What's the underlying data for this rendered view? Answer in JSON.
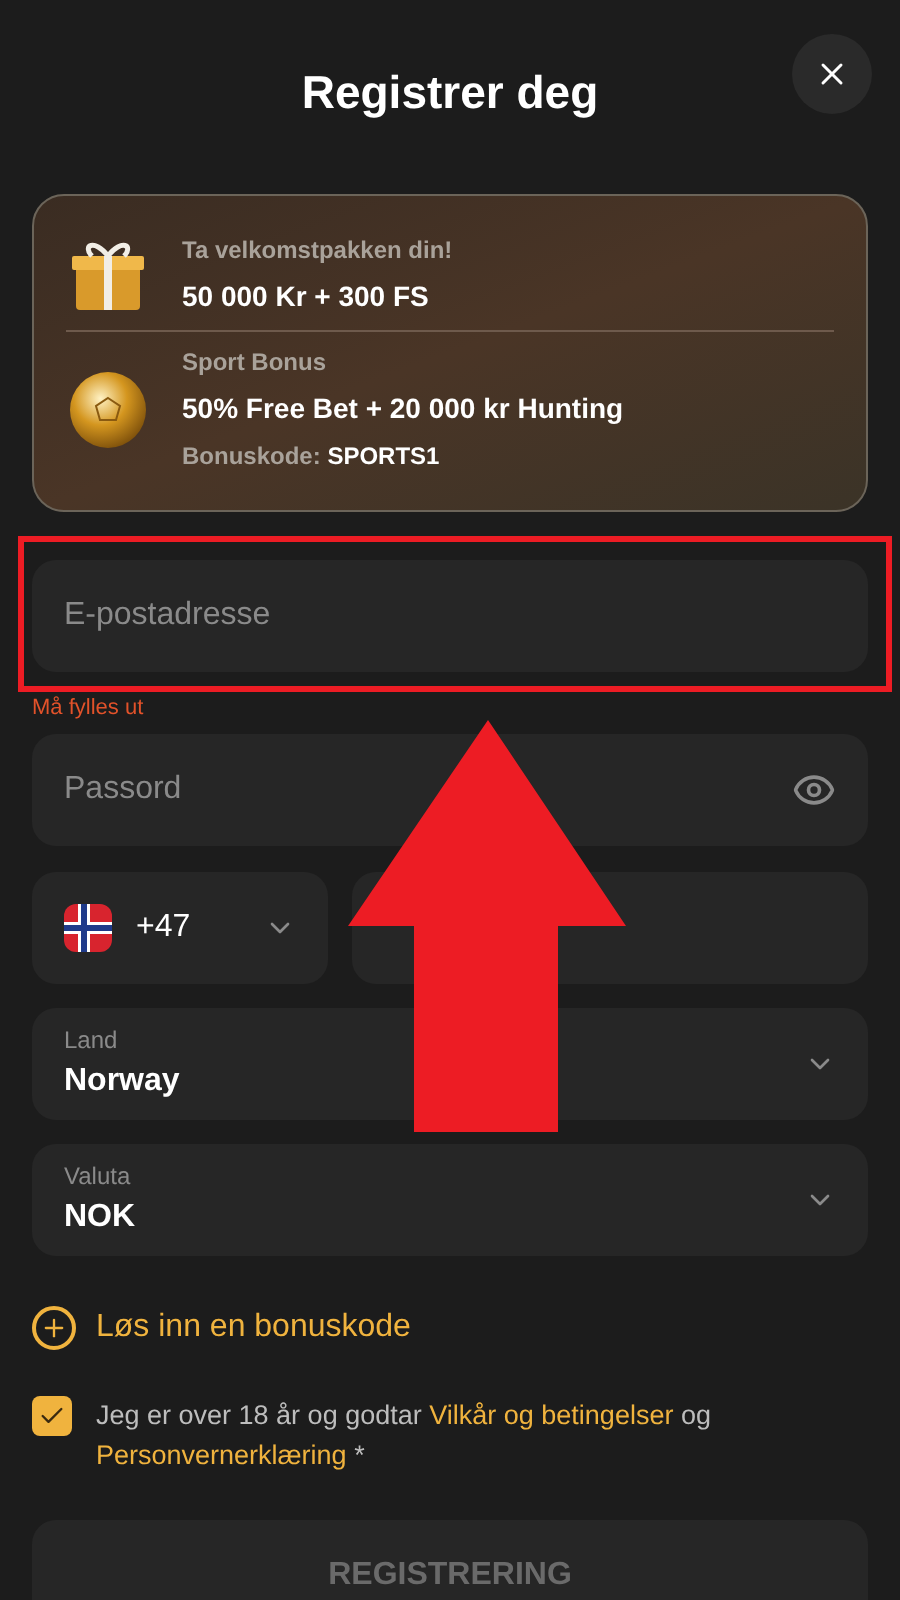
{
  "title": "Registrer deg",
  "offers": [
    {
      "kind": "gift",
      "caption": "Ta velkomstpakken din!",
      "headline": "50 000 Kr + 300 FS"
    },
    {
      "kind": "ball",
      "caption": "Sport Bonus",
      "headline": "50% Free Bet + 20 000 kr Hunting",
      "code_label": "Bonuskode:",
      "code": "SPORTS1"
    }
  ],
  "email": {
    "placeholder": "E-postadresse",
    "error": "Må fylles ut"
  },
  "password": {
    "placeholder": "Passord"
  },
  "phone": {
    "code": "+47"
  },
  "selects": [
    {
      "label": "Land",
      "value": "Norway"
    },
    {
      "label": "Valuta",
      "value": "NOK"
    }
  ],
  "bonus_link": "Løs inn en bonuskode",
  "consent": {
    "checked": true,
    "text": "Jeg er over 18 år og godtar",
    "link1": "Vilkår og betingelser",
    "joiner": "og",
    "link2": "Personvernerklæring",
    "required": "*"
  },
  "submit": "REGISTRERING"
}
